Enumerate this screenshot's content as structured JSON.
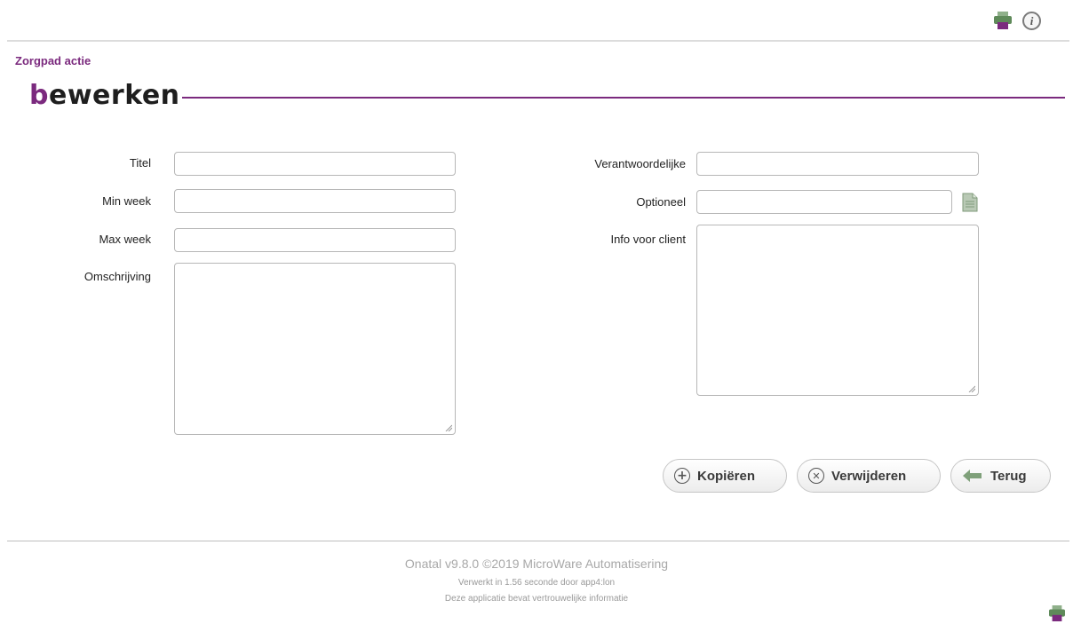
{
  "header": {
    "icons": [
      "printer-icon",
      "info-icon"
    ],
    "info_glyph": "i"
  },
  "page": {
    "section_label": "Zorgpad actie",
    "heading_first": "b",
    "heading_rest": "ewerken"
  },
  "form": {
    "left": {
      "titel": {
        "label": "Titel",
        "value": ""
      },
      "min_week": {
        "label": "Min week",
        "value": ""
      },
      "max_week": {
        "label": "Max week",
        "value": ""
      },
      "omschrijving": {
        "label": "Omschrijving",
        "value": ""
      }
    },
    "right": {
      "verantwoordelijke": {
        "label": "Verantwoordelijke",
        "value": ""
      },
      "optioneel": {
        "label": "Optioneel",
        "value": "",
        "icon": "document-icon"
      },
      "info_voor_client": {
        "label": "Info voor client",
        "value": ""
      }
    }
  },
  "buttons": {
    "kopieren": {
      "label": "Kopiëren",
      "icon": "plus-circle-icon"
    },
    "verwijderen": {
      "label": "Verwijderen",
      "icon": "x-circle-icon"
    },
    "terug": {
      "label": "Terug",
      "icon": "back-arrow-icon"
    }
  },
  "footer": {
    "line1": "Onatal v9.8.0 ©2019 MicroWare Automatisering",
    "line2": "Verwerkt in 1.56 seconde door app4:lon",
    "line3": "Deze applicatie bevat vertrouwelijke informatie",
    "icon": "printer-icon"
  },
  "colors": {
    "brand": "#7b2a7e",
    "printer_body": "#5f8a5a",
    "printer_paper": "#7b2a7e"
  }
}
